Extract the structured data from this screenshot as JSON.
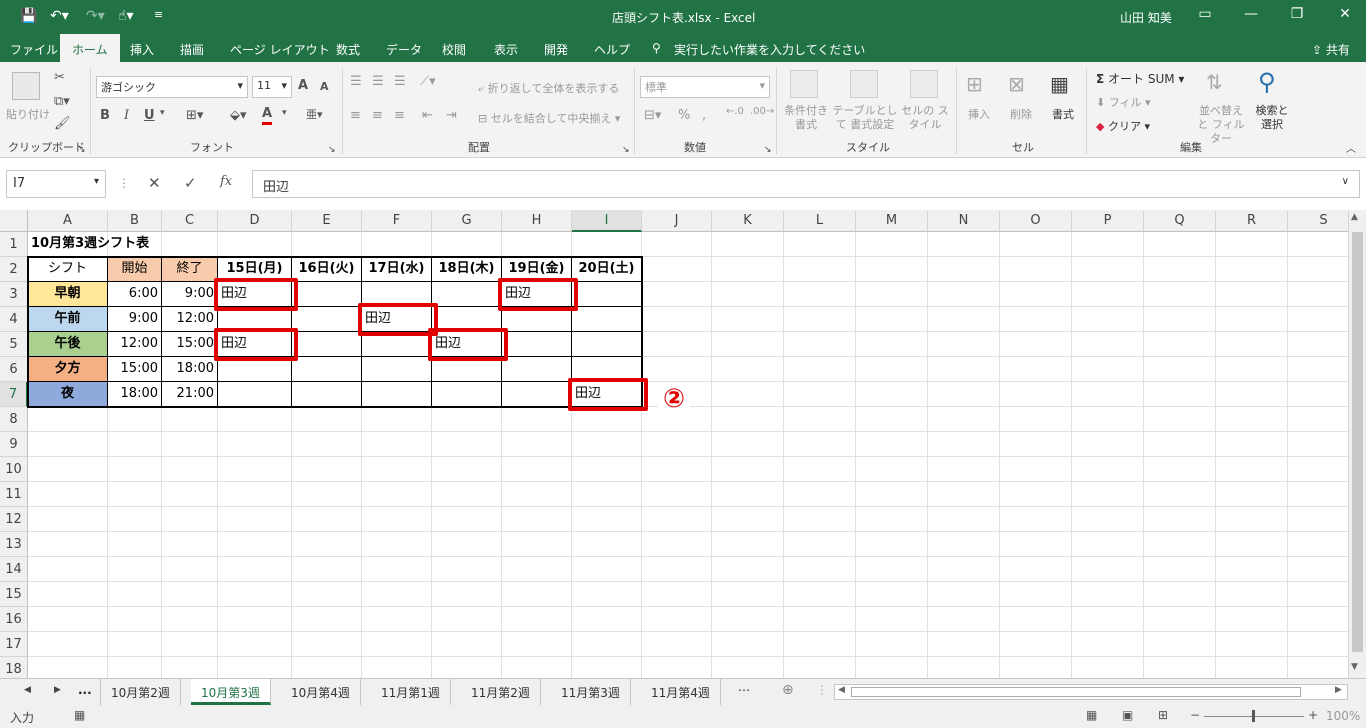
{
  "title_bar": {
    "title": "店頭シフト表.xlsx  -  Excel",
    "user": "山田 知美"
  },
  "ribbon_tabs": [
    "ファイル",
    "ホーム",
    "挿入",
    "描画",
    "ページ レイアウト",
    "数式",
    "データ",
    "校閲",
    "表示",
    "開発",
    "ヘルプ"
  ],
  "active_tab": "ホーム",
  "tell_me": "実行したい作業を入力してください",
  "share": "共有",
  "ribbon": {
    "clipboard": {
      "paste": "貼り付け",
      "group": "クリップボード"
    },
    "font": {
      "name": "游ゴシック",
      "size": "11",
      "bold": "B",
      "italic": "I",
      "underline": "U",
      "grow": "A",
      "shrink": "A",
      "color": "A",
      "group": "フォント"
    },
    "alignment": {
      "wrap": "折り返して全体を表示する",
      "merge": "セルを結合して中央揃え",
      "group": "配置"
    },
    "number": {
      "format": "標準",
      "group": "数値"
    },
    "styles": {
      "conditional": "条件付き 書式",
      "table": "テーブルとして 書式設定",
      "cell": "セルの スタイル",
      "group": "スタイル"
    },
    "cells": {
      "insert": "挿入",
      "delete": "削除",
      "format": "書式",
      "group": "セル"
    },
    "editing": {
      "autosum": "オート SUM",
      "fill": "フィル",
      "clear": "クリア",
      "sort": "並べ替えと フィルター",
      "find": "検索と 選択",
      "group": "編集"
    }
  },
  "formula_bar": {
    "name_box": "I7",
    "content": "田辺"
  },
  "columns": [
    "A",
    "B",
    "C",
    "D",
    "E",
    "F",
    "G",
    "H",
    "I",
    "J",
    "K",
    "L",
    "M",
    "N",
    "O",
    "P",
    "Q",
    "R",
    "S"
  ],
  "selected_column": "I",
  "rows": [
    "1",
    "2",
    "3",
    "4",
    "5",
    "6",
    "7",
    "8",
    "9",
    "10",
    "11",
    "12",
    "13",
    "14",
    "15",
    "16",
    "17",
    "18"
  ],
  "selected_row": "7",
  "sheet": {
    "title": "10月第3週シフト表",
    "header": {
      "shift": "シフト",
      "start": "開始",
      "end": "終了",
      "days": [
        "15日(月)",
        "16日(火)",
        "17日(水)",
        "18日(木)",
        "19日(金)",
        "20日(土)"
      ]
    },
    "shifts": [
      {
        "name": "早朝",
        "start": "6:00",
        "end": "9:00",
        "color": "#ffe699",
        "cells": [
          "田辺",
          "",
          "",
          "",
          "田辺",
          ""
        ]
      },
      {
        "name": "午前",
        "start": "9:00",
        "end": "12:00",
        "color": "#bdd7ee",
        "cells": [
          "",
          "",
          "田辺",
          "",
          "",
          ""
        ]
      },
      {
        "name": "午後",
        "start": "12:00",
        "end": "15:00",
        "color": "#a9d08e",
        "cells": [
          "田辺",
          "",
          "",
          "田辺",
          "",
          ""
        ]
      },
      {
        "name": "夕方",
        "start": "15:00",
        "end": "18:00",
        "color": "#f4b084",
        "cells": [
          "",
          "",
          "",
          "",
          "",
          ""
        ]
      },
      {
        "name": "夜",
        "start": "18:00",
        "end": "21:00",
        "color": "#8ea9db",
        "cells": [
          "",
          "",
          "",
          "",
          "",
          "田辺"
        ]
      }
    ]
  },
  "annotation": "②",
  "sheet_tabs": [
    "...",
    "10月第2週",
    "10月第3週",
    "10月第4週",
    "11月第1週",
    "11月第2週",
    "11月第3週",
    "11月第4週"
  ],
  "active_sheet": "10月第3週",
  "status": {
    "mode": "入力",
    "zoom": "100%"
  },
  "colors": {
    "excel_green": "#217346",
    "highlight_red": "#e00000",
    "start_header": "#f8cbad"
  }
}
